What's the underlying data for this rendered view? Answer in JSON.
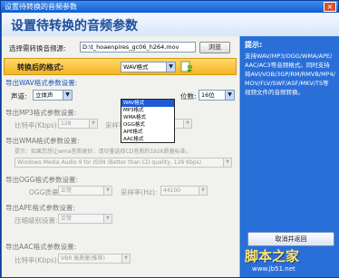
{
  "window": {
    "title": "设置待转换的音频参数",
    "close_glyph": "×"
  },
  "header": {
    "title": "设置待转换的音频参数"
  },
  "source": {
    "label": "选择需转换音频源:",
    "value": "D:\\t_hoaenpires_gc06_h264.mov",
    "browse_label": "浏览"
  },
  "format": {
    "label": "转换后的格式:",
    "selected": "WAV格式",
    "options": [
      "WAV格式",
      "MP3格式",
      "WMA格式",
      "OGG格式",
      "APE格式",
      "AAC格式"
    ]
  },
  "wav_section": {
    "title": "导出WAV格式参数设置:",
    "channel_label": "声道:",
    "channel_value": "立体声",
    "bits_label": "位数:",
    "bits_value": "16位"
  },
  "mp3_section": {
    "title": "导出MP3格式参数设置:",
    "bitrate_label": "比特率(Kbps):",
    "bitrate_value": "128",
    "samplerate_label": "采样率(Hz):",
    "samplerate_value": "44100"
  },
  "wma_section": {
    "title": "导出WMA格式参数设置:",
    "hint": "提示：如果您想让wma音质更好，请尽量选择CD音质的192K质量标准。",
    "quality_value": "Windows Media Audio 9 for ISSN (Better than CD quality, 128 Kbps)"
  },
  "ogg_section": {
    "title": "导出OGG格式参数设置:",
    "quality_label": "OGG质量:",
    "quality_value": "正常",
    "samplerate_label": "采样率(Hz):",
    "samplerate_value": "44100"
  },
  "ape_section": {
    "title": "导出APE格式参数设置:",
    "level_label": "压缩级别设置:",
    "level_value": "正常"
  },
  "aac_section": {
    "title": "导出AAC格式参数设置:",
    "bitrate_label": "比特率(Kbps):",
    "bitrate_value": "VBR 高质量(推荐)"
  },
  "tips": {
    "heading": "提示:",
    "lines": [
      "支持WAV/MP3/OGG/WMA/APE/",
      "AAC/AC3等音频格式。同时支持",
      "将AVI/VOB/3GP/RM/RMVB/MP4/",
      "MOV/FLV/SWF/ASF/MKV/TS等",
      "视频文件的音频转换。"
    ]
  },
  "buttons": {
    "cancel_label": "取消并返回"
  },
  "watermark": {
    "brand": "脚本之家",
    "url": "www.jb51.net"
  },
  "colors": {
    "title_bar": "#0f5ccf",
    "tips_panel": "#2a6fd8",
    "format_bar": "#f5b526",
    "section_text": "#1f56b7"
  }
}
